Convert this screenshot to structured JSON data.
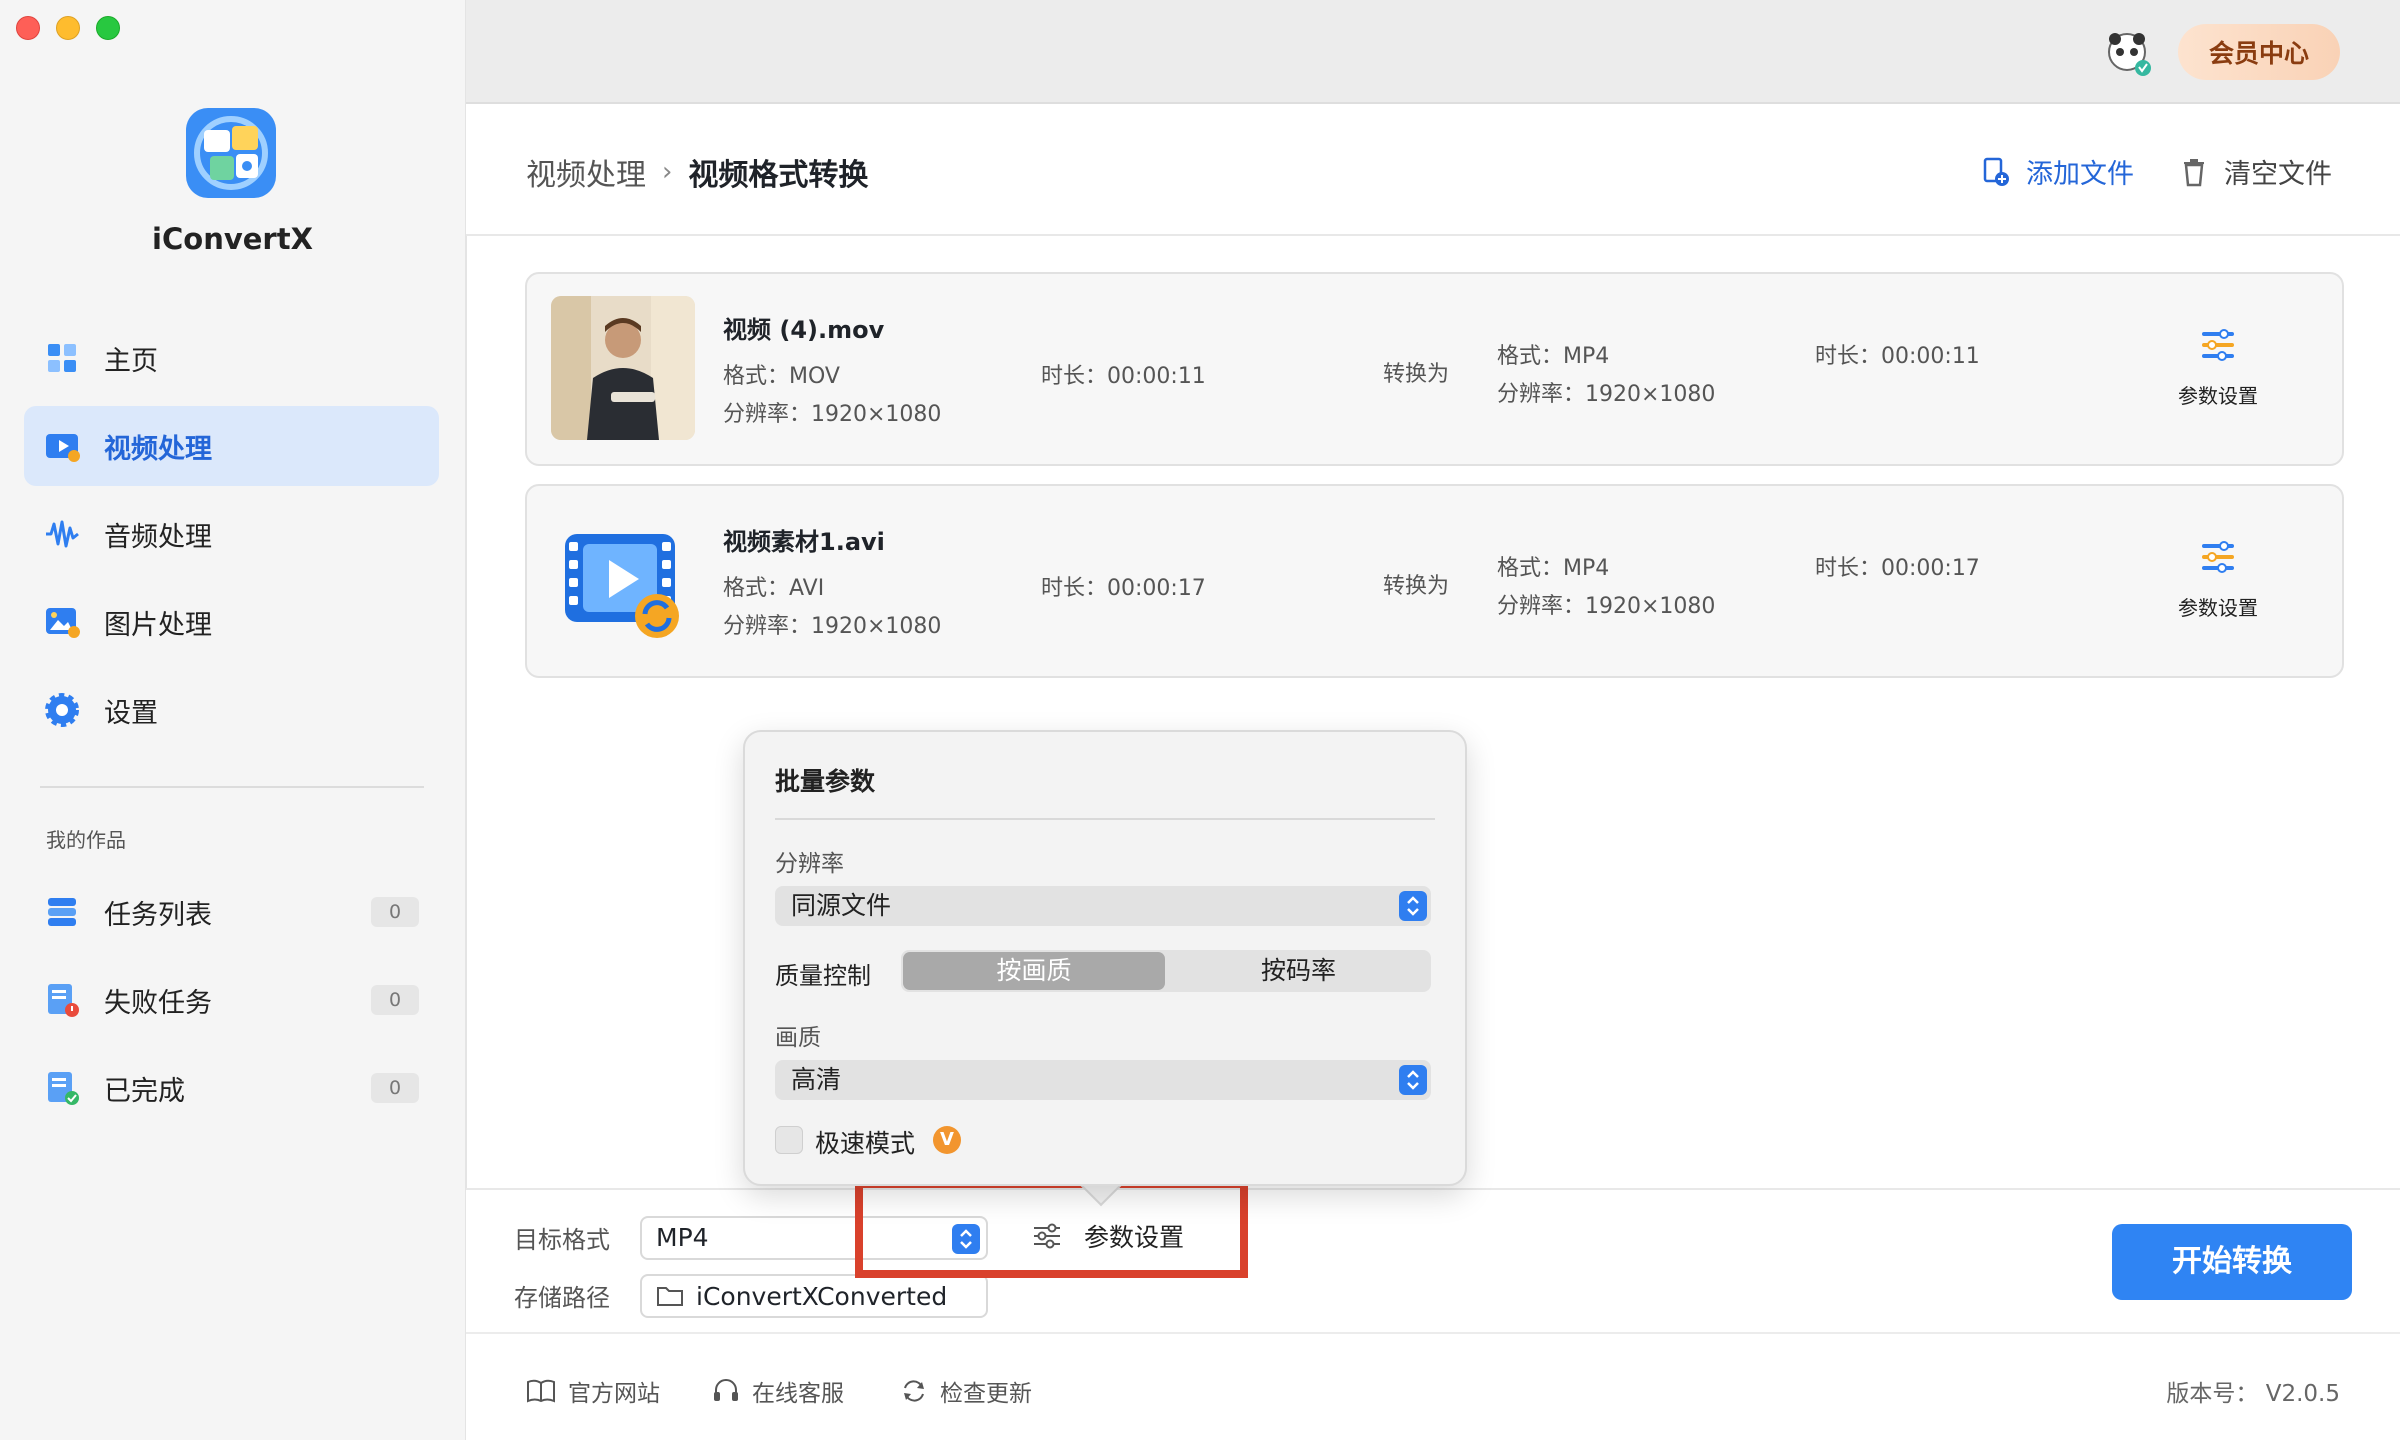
{
  "app": {
    "name": "iConvertX"
  },
  "sidebar": {
    "items": [
      {
        "label": "主页",
        "icon": "home-icon"
      },
      {
        "label": "视频处理",
        "icon": "video-processing-icon"
      },
      {
        "label": "音频处理",
        "icon": "audio-wave-icon"
      },
      {
        "label": "图片处理",
        "icon": "image-processing-icon"
      },
      {
        "label": "设置",
        "icon": "gear-icon"
      }
    ],
    "section_title": "我的作品",
    "works": [
      {
        "label": "任务列表",
        "count": "0",
        "icon": "task-list-icon"
      },
      {
        "label": "失败任务",
        "count": "0",
        "icon": "failed-task-icon"
      },
      {
        "label": "已完成",
        "count": "0",
        "icon": "completed-icon"
      }
    ]
  },
  "topbar": {
    "member_label": "会员中心"
  },
  "header": {
    "breadcrumb_parent": "视频处理",
    "breadcrumb_sep": "›",
    "breadcrumb_current": "视频格式转换",
    "add_file": "添加文件",
    "clear_file": "清空文件"
  },
  "files": [
    {
      "name": "视频 (4).mov",
      "src_format": "格式：MOV",
      "src_duration": "时长：00:00:11",
      "src_resolution": "分辨率：1920×1080",
      "convert_to": "转换为",
      "dst_format": "格式：MP4",
      "dst_duration": "时长：00:00:11",
      "dst_resolution": "分辨率：1920×1080",
      "param_label": "参数设置"
    },
    {
      "name": "视频素材1.avi",
      "src_format": "格式：AVI",
      "src_duration": "时长：00:00:17",
      "src_resolution": "分辨率：1920×1080",
      "convert_to": "转换为",
      "dst_format": "格式：MP4",
      "dst_duration": "时长：00:00:17",
      "dst_resolution": "分辨率：1920×1080",
      "param_label": "参数设置"
    }
  ],
  "popover": {
    "title": "批量参数",
    "resolution_label": "分辨率",
    "resolution_value": "同源文件",
    "quality_control_label": "质量控制",
    "quality_options": [
      "按画质",
      "按码率"
    ],
    "quality_selected": "按画质",
    "quality_label": "画质",
    "quality_value": "高清",
    "fast_mode_label": "极速模式",
    "fast_mode_checked": false,
    "vip_badge": "V"
  },
  "bottom": {
    "target_format_label": "目标格式",
    "target_format_value": "MP4",
    "save_path_label": "存储路径",
    "save_path_value": "iConvertXConverted",
    "param_settings": "参数设置",
    "start_button": "开始转换"
  },
  "footer": {
    "website": "官方网站",
    "support": "在线客服",
    "update": "检查更新",
    "version": "版本号： V2.0.5"
  },
  "colors": {
    "accent": "#2f84f3",
    "active_nav_bg": "#dbe8fb",
    "highlight_border": "#d9412c",
    "member_text": "#8a3c10"
  }
}
